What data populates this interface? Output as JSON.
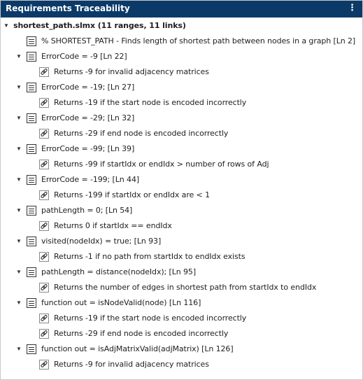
{
  "panel": {
    "title": "Requirements Traceability",
    "menu_icon": "vertical-ellipsis-icon"
  },
  "root": {
    "label": "shortest_path.slmx (11 ranges, 11 links)"
  },
  "items": [
    {
      "text": "% SHORTEST_PATH - Finds length of shortest path between nodes in a graph [Ln 2]",
      "links": []
    },
    {
      "text": "ErrorCode = -9 [Ln 22]",
      "links": [
        "Returns -9 for invalid adjacency matrices"
      ]
    },
    {
      "text": "ErrorCode = -19; [Ln 27]",
      "links": [
        "Returns -19 if the start node is encoded incorrectly"
      ]
    },
    {
      "text": "ErrorCode = -29; [Ln 32]",
      "links": [
        "Returns -29 if end node is encoded incorrectly"
      ]
    },
    {
      "text": "ErrorCode = -99; [Ln 39]",
      "links": [
        "Returns -99 if startIdx or endIdx > number of rows of Adj"
      ]
    },
    {
      "text": "ErrorCode = -199; [Ln 44]",
      "links": [
        "Returns -199 if startIdx or endIdx are < 1"
      ]
    },
    {
      "text": "pathLength = 0; [Ln 54]",
      "links": [
        "Returns 0 if startIdx == endIdx"
      ]
    },
    {
      "text": "visited(nodeIdx) = true; [Ln 93]",
      "links": [
        "Returns -1 if no path from startIdx to endIdx exists"
      ]
    },
    {
      "text": "pathLength = distance(nodeIdx); [Ln 95]",
      "links": [
        "Returns the number of edges in shortest path from startIdx to endIdx"
      ]
    },
    {
      "text": "function out = isNodeValid(node) [Ln 116]",
      "links": [
        "Returns -19 if the start node is encoded incorrectly",
        "Returns -29 if end node is encoded incorrectly"
      ]
    },
    {
      "text": "function out = isAdjMatrixValid(adjMatrix) [Ln 126]",
      "links": [
        "Returns -9 for invalid adjacency matrices"
      ]
    }
  ]
}
